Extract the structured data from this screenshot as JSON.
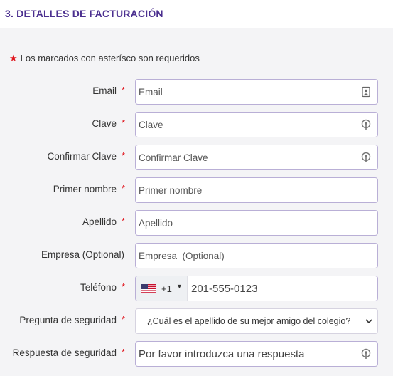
{
  "header": {
    "title": "3. DETALLES DE FACTURACIÓN"
  },
  "required_note": {
    "star": "★",
    "text": "Los marcados con asterísco son requeridos"
  },
  "required_star": "*",
  "fields": {
    "email": {
      "label": "Email",
      "placeholder": "Email",
      "icon": "contact-card-icon"
    },
    "password": {
      "label": "Clave",
      "placeholder": "Clave",
      "icon": "key-icon"
    },
    "confirm_password": {
      "label": "Confirmar Clave",
      "placeholder": "Confirmar Clave",
      "icon": "key-icon"
    },
    "first_name": {
      "label": "Primer nombre",
      "placeholder": "Primer nombre"
    },
    "last_name": {
      "label": "Apellido",
      "placeholder": "Apellido"
    },
    "company": {
      "label": "Empresa (Optional)",
      "placeholder": "Empresa  (Optional)"
    },
    "phone": {
      "label": "Teléfono",
      "country_code": "+1",
      "caret": "▼",
      "placeholder": "201-555-0123",
      "flag": "us-flag-icon"
    },
    "security_question": {
      "label": "Pregunta de seguridad",
      "selected": "¿Cuál es el apellido de su mejor amigo del colegio?"
    },
    "security_answer": {
      "label": "Respuesta de seguridad",
      "placeholder": "Por favor introduzca una respuesta",
      "icon": "key-icon"
    }
  },
  "colors": {
    "accent": "#4b2f8f",
    "required": "#e0171f",
    "border": "#b9afd6",
    "background": "#f4f4f6"
  }
}
